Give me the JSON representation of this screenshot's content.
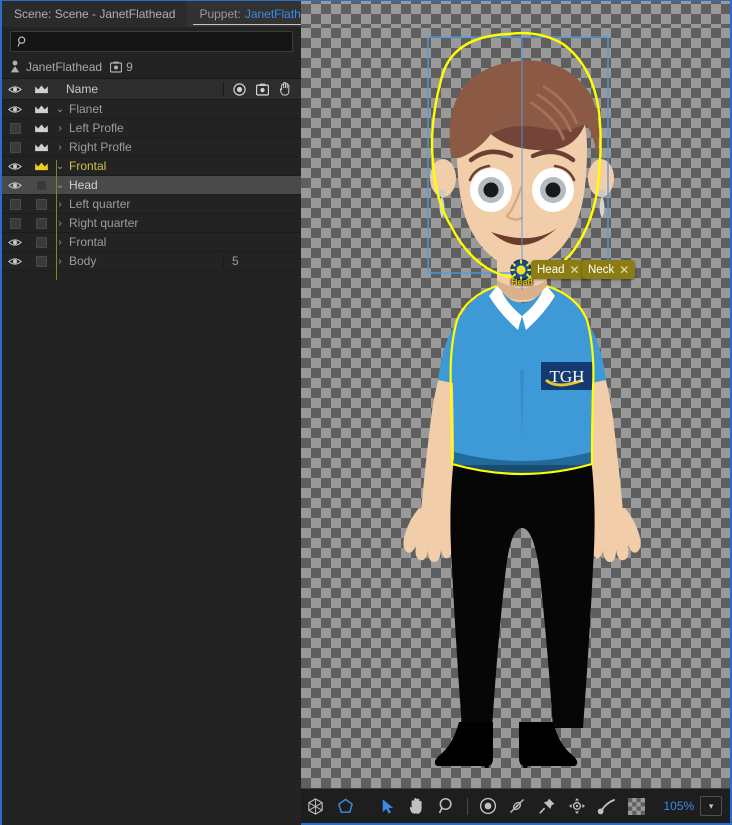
{
  "tabs": [
    {
      "label": "Scene: Scene - JanetFlathead",
      "active": false,
      "name": "tab-scene"
    },
    {
      "label": "Puppet:",
      "puppet": "JanetFlathead",
      "active": true,
      "name": "tab-puppet"
    }
  ],
  "tab_menu_icon": "hamburger-menu-icon",
  "search": {
    "value": "",
    "placeholder": "",
    "icon": "search-icon"
  },
  "puppet_info": {
    "icon": "puppet-icon",
    "name": "JanetFlathead",
    "trigger_icon": "puppet-badge-icon",
    "trigger_count": "9"
  },
  "list_header": {
    "eye_icon": "eye-icon",
    "crown_icon": "crown-icon",
    "name": "Name",
    "col_icons": [
      "record-icon",
      "puppet-badge-icon",
      "hand-trigger-icon"
    ]
  },
  "layers": [
    {
      "name": "Flanet",
      "indent": 0,
      "twisty": "⌄",
      "expanded": true,
      "visible": true,
      "crown": "crown-white",
      "highlight": false,
      "selected": false,
      "value": ""
    },
    {
      "name": "Left Profle",
      "indent": 1,
      "twisty": "›",
      "expanded": false,
      "visible": false,
      "crown": "crown-white",
      "highlight": false,
      "selected": false,
      "value": ""
    },
    {
      "name": "Right Profle",
      "indent": 1,
      "twisty": "›",
      "expanded": false,
      "visible": false,
      "crown": "crown-white",
      "highlight": false,
      "selected": false,
      "value": ""
    },
    {
      "name": "Frontal",
      "indent": 1,
      "twisty": "⌄",
      "expanded": true,
      "visible": true,
      "crown": "crown-yellow",
      "highlight": true,
      "selected": false,
      "value": ""
    },
    {
      "name": "Head",
      "indent": 2,
      "twisty": "⌄",
      "expanded": true,
      "visible": true,
      "crown": "box",
      "highlight": false,
      "selected": true,
      "value": ""
    },
    {
      "name": "Left quarter",
      "indent": 3,
      "twisty": "›",
      "expanded": false,
      "visible": false,
      "crown": "box",
      "highlight": false,
      "selected": false,
      "value": ""
    },
    {
      "name": "Right quarter",
      "indent": 3,
      "twisty": "›",
      "expanded": false,
      "visible": false,
      "crown": "box",
      "highlight": false,
      "selected": false,
      "value": ""
    },
    {
      "name": "Frontal",
      "indent": 3,
      "twisty": "›",
      "expanded": false,
      "visible": true,
      "crown": "box",
      "highlight": false,
      "selected": false,
      "value": ""
    },
    {
      "name": "Body",
      "indent": 2,
      "twisty": "›",
      "expanded": false,
      "visible": true,
      "crown": "box",
      "highlight": false,
      "selected": false,
      "value": "5"
    }
  ],
  "canvas": {
    "tags": [
      {
        "label": "Head",
        "close": "✕"
      },
      {
        "label": "Neck",
        "close": "✕"
      }
    ],
    "handle_label": "Head",
    "handle_icon": "origin-handle-icon",
    "logo_text": "TGH",
    "selection_outline_color": "#ffff00",
    "bounding_box_color": "#4a9ee8"
  },
  "toolbar": {
    "tools": [
      {
        "name": "transform-icon",
        "active": false
      },
      {
        "name": "polygon-mesh-icon",
        "active": true
      },
      {
        "name": "select-arrow-icon",
        "active": true
      },
      {
        "name": "hand-icon",
        "active": false
      },
      {
        "name": "zoom-magnifier-icon",
        "active": false
      },
      {
        "name": "origin-handle-icon",
        "active": false
      },
      {
        "name": "dangle-handle-icon",
        "active": false
      },
      {
        "name": "pin-icon",
        "active": false
      },
      {
        "name": "stick-handle-icon",
        "active": false
      },
      {
        "name": "draggable-handle-icon",
        "active": false
      }
    ],
    "transparency_icon": "transparency-grid-icon",
    "zoom_level": "105%",
    "zoom_dropdown_icon": "chevron-down-icon"
  }
}
